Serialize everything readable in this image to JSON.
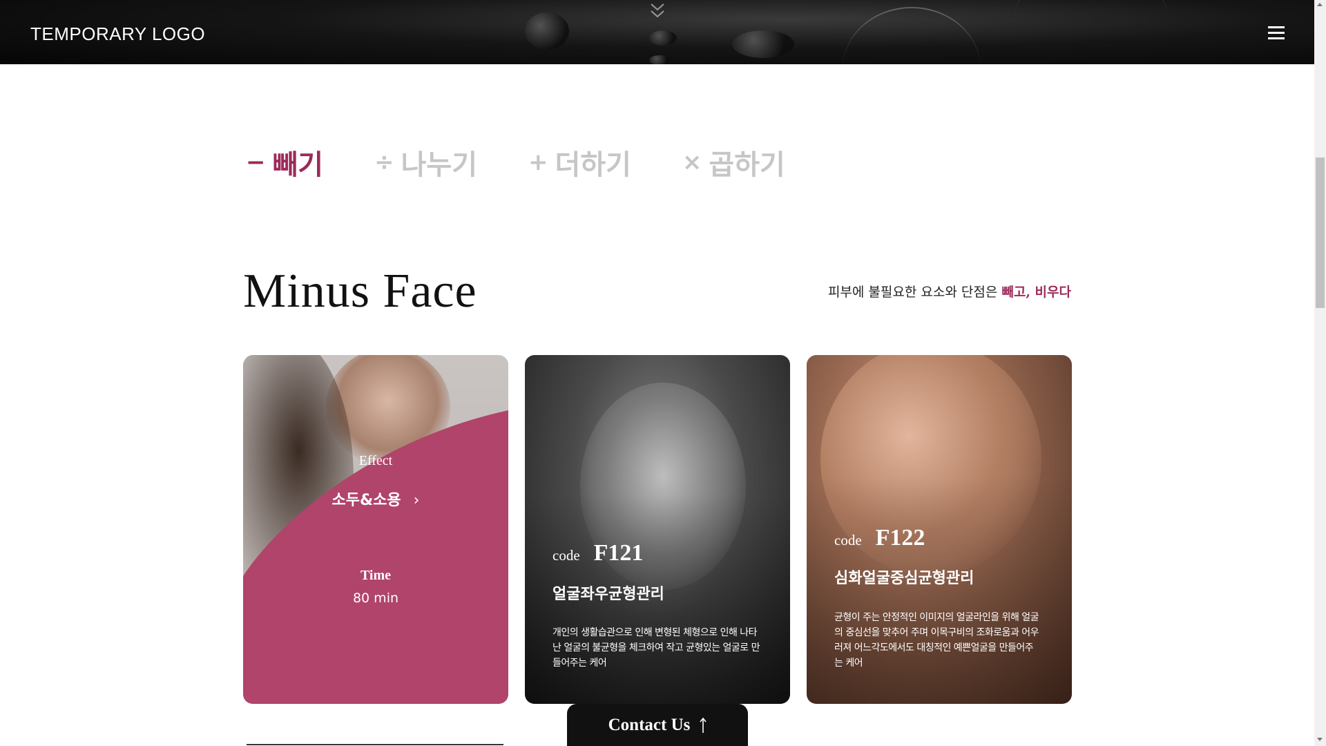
{
  "header": {
    "logo": "TEMPORARY LOGO"
  },
  "tabs": [
    {
      "symbol": "−",
      "label": "빼기",
      "active": true
    },
    {
      "symbol": "÷",
      "label": "나누기",
      "active": false
    },
    {
      "symbol": "+",
      "label": "더하기",
      "active": false
    },
    {
      "symbol": "×",
      "label": "곱하기",
      "active": false
    }
  ],
  "section": {
    "title": "Minus Face",
    "desc_prefix": "피부에 불필요한 요소와 단점은 ",
    "desc_highlight": "빼고, 비우다"
  },
  "cards": {
    "card1": {
      "effect_label": "Effect",
      "effect_value": "소두&소용",
      "time_label": "Time",
      "time_value": "80 min"
    },
    "card2": {
      "code_label": "code",
      "code": "F121",
      "name": "얼굴좌우균형관리",
      "desc": "개인의 생활습관으로 인해 변형된 체형으로 인해 나타난 얼굴의 불균형을 체크하여 작고 균형있는 얼굴로 만들어주는 케어"
    },
    "card3": {
      "code_label": "code",
      "code": "F122",
      "name": "심화얼굴중심균형관리",
      "desc": "균형이 주는 안정적인 이미지의 얼굴라인을 위해 얼굴의 중심선을 맞추어 주며 이목구비의 조화로움과 어우러져 어느각도에서도 대칭적인 예쁜얼굴을 만들어주는 케어"
    }
  },
  "contact": {
    "label": "Contact Us"
  },
  "colors": {
    "accent": "#9c2a5a",
    "card_pink": "#b0446a",
    "inactive_tab": "#c6c6c6"
  }
}
